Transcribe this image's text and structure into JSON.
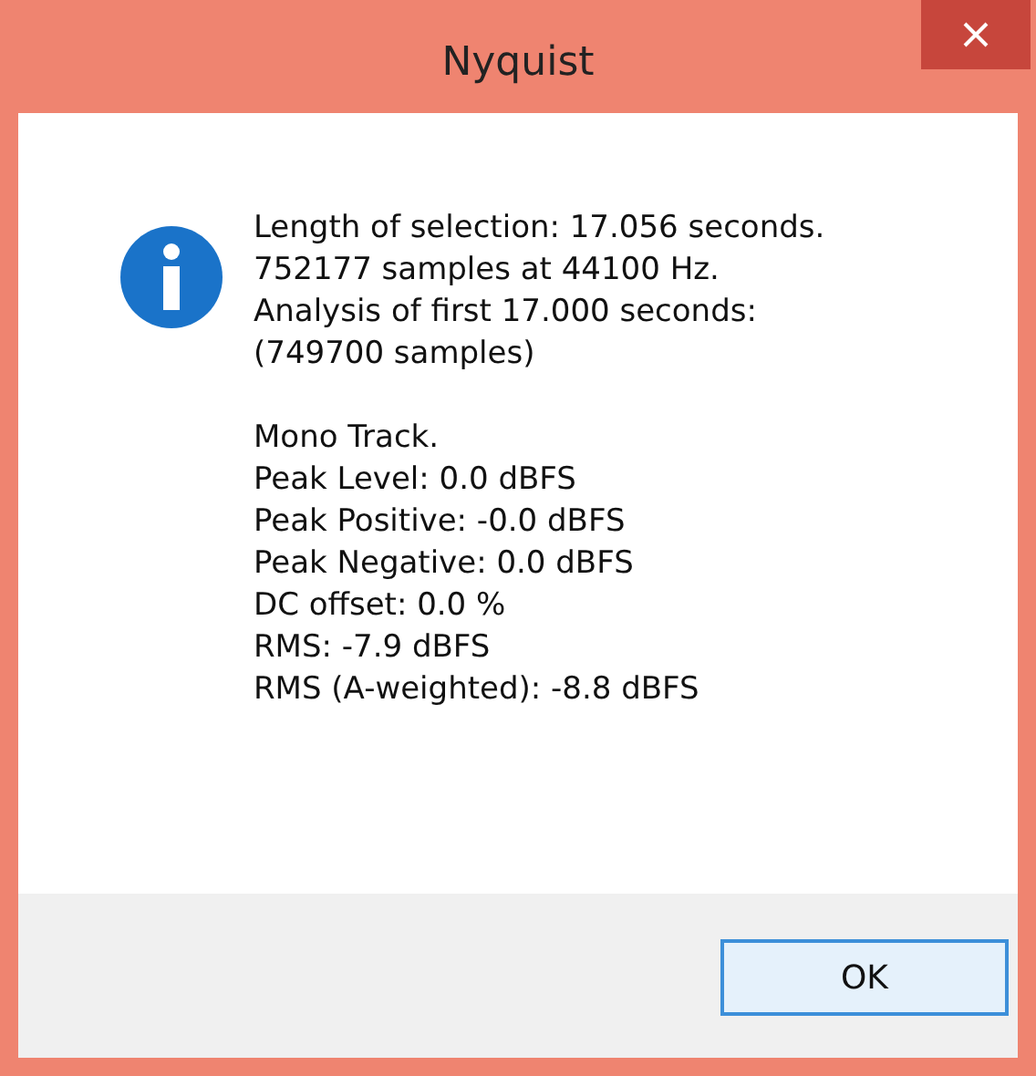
{
  "window": {
    "title": "Nyquist"
  },
  "message": {
    "paragraphs": [
      [
        "Length of selection: 17.056 seconds.",
        "752177 samples at 44100 Hz.",
        "Analysis of first 17.000 seconds:",
        "(749700 samples)"
      ],
      [
        "Mono Track.",
        "Peak Level: 0.0 dBFS",
        "Peak Positive: -0.0 dBFS",
        "Peak Negative: 0.0 dBFS",
        "DC offset: 0.0 %",
        "RMS: -7.9 dBFS",
        "RMS (A-weighted): -8.8 dBFS"
      ]
    ]
  },
  "buttons": [
    "OK"
  ]
}
